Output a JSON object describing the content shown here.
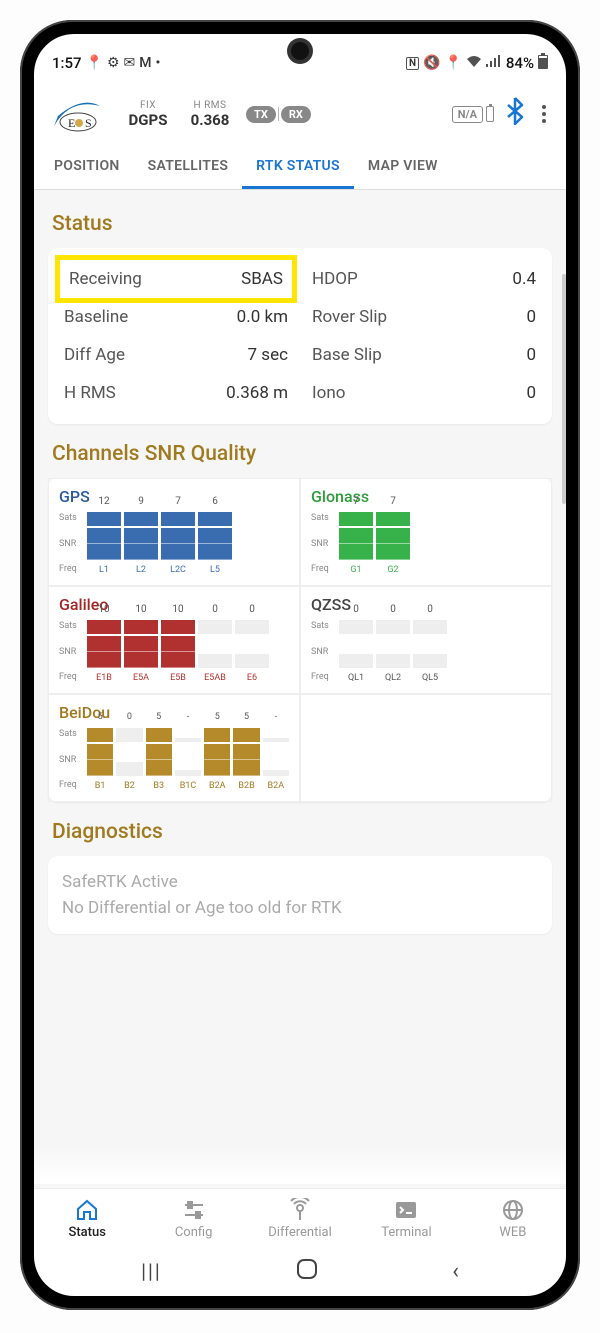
{
  "statusbar": {
    "time": "1:57",
    "battery_pct": "84%"
  },
  "header": {
    "fix_label": "FIX",
    "fix_value": "DGPS",
    "hrms_label": "H RMS",
    "hrms_value": "0.368",
    "tx": "TX",
    "rx": "RX",
    "na": "N/A"
  },
  "tabs": {
    "position": "POSITION",
    "satellites": "SATELLITES",
    "rtk": "RTK STATUS",
    "map": "MAP VIEW"
  },
  "sections": {
    "status": "Status",
    "snr": "Channels SNR Quality",
    "diag": "Diagnostics"
  },
  "status": {
    "receiving_l": "Receiving",
    "receiving_v": "SBAS",
    "hdop_l": "HDOP",
    "hdop_v": "0.4",
    "baseline_l": "Baseline",
    "baseline_v": "0.0 km",
    "rover_l": "Rover Slip",
    "rover_v": "0",
    "diffage_l": "Diff Age",
    "diffage_v": "7 sec",
    "base_l": "Base Slip",
    "base_v": "0",
    "hrms_l": "H RMS",
    "hrms_v": "0.368 m",
    "iono_l": "Iono",
    "iono_v": "0"
  },
  "snr": {
    "gps": {
      "name": "GPS",
      "sats": [
        "12",
        "9",
        "7",
        "6"
      ],
      "heights": [
        100,
        100,
        100,
        100
      ],
      "freq": [
        "L1",
        "L2",
        "L2C",
        "L5"
      ]
    },
    "glonass": {
      "name": "Glonass",
      "sats": [
        "7",
        "7"
      ],
      "heights": [
        100,
        100
      ],
      "freq": [
        "G1",
        "G2"
      ]
    },
    "galileo": {
      "name": "Galileo",
      "sats": [
        "10",
        "10",
        "10",
        "0",
        "0"
      ],
      "heights": [
        100,
        100,
        100,
        0,
        0
      ],
      "freq": [
        "E1B",
        "E5A",
        "E5B",
        "E5AB",
        "E6"
      ]
    },
    "qzss": {
      "name": "QZSS",
      "sats": [
        "0",
        "0",
        "0"
      ],
      "heights": [
        0,
        0,
        0
      ],
      "freq": [
        "QL1",
        "QL2",
        "QL5"
      ]
    },
    "beidou": {
      "name": "BeiDou",
      "sats": [
        "5",
        "0",
        "5",
        "-",
        "5",
        "5",
        "-"
      ],
      "heights": [
        100,
        0,
        100,
        10,
        100,
        100,
        10
      ],
      "freq": [
        "B1",
        "B2",
        "B3",
        "B1C",
        "B2A",
        "B2B",
        "B2A"
      ]
    }
  },
  "labels": {
    "sats": "Sats",
    "snr": "SNR",
    "freq": "Freq"
  },
  "diag": {
    "line1": "SafeRTK Active",
    "line2": "No Differential or Age too old for RTK"
  },
  "bottomnav": {
    "status": "Status",
    "config": "Config",
    "diff": "Differential",
    "term": "Terminal",
    "web": "WEB"
  }
}
